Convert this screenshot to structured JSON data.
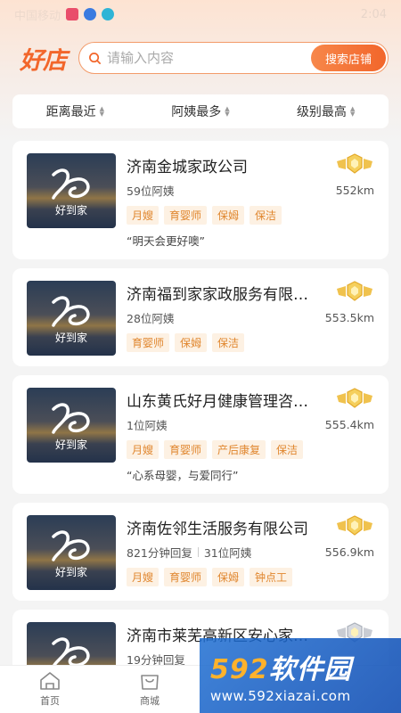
{
  "status_bar": {
    "left_text": "中国移动",
    "right_text": "2:04"
  },
  "header": {
    "logo": "好店"
  },
  "search": {
    "placeholder": "请输入内容",
    "button_label": "搜索店铺"
  },
  "filters": [
    {
      "label": "距离最近"
    },
    {
      "label": "阿姨最多"
    },
    {
      "label": "级别最高"
    }
  ],
  "thumb_caption": "好到家",
  "stores": [
    {
      "name": "济南金城家政公司",
      "reply": "",
      "count": "59位阿姨",
      "distance": "552km",
      "tags": [
        "月嫂",
        "育婴师",
        "保姆",
        "保洁"
      ],
      "slogan": "“明天会更好噢”",
      "badge": "gold"
    },
    {
      "name": "济南福到家家政服务有限…",
      "reply": "",
      "count": "28位阿姨",
      "distance": "553.5km",
      "tags": [
        "育婴师",
        "保姆",
        "保洁"
      ],
      "slogan": "",
      "badge": "gold"
    },
    {
      "name": "山东黄氏好月健康管理咨…",
      "reply": "",
      "count": "1位阿姨",
      "distance": "555.4km",
      "tags": [
        "月嫂",
        "育婴师",
        "产后康复",
        "保洁"
      ],
      "slogan": "“心系母婴，与爱同行”",
      "badge": "gold"
    },
    {
      "name": "济南佐邻生活服务有限公司",
      "reply": "821分钟回复",
      "count": "31位阿姨",
      "distance": "556.9km",
      "tags": [
        "月嫂",
        "育婴师",
        "保姆",
        "钟点工"
      ],
      "slogan": "",
      "badge": "gold"
    },
    {
      "name": "济南市莱芜高新区安心家…",
      "reply": "19分钟回复",
      "count": "",
      "distance": "",
      "tags": [],
      "slogan": "",
      "badge": "silver"
    }
  ],
  "tabbar": [
    {
      "label": "首页",
      "icon": "home-icon"
    },
    {
      "label": "商城",
      "icon": "shop-bag-icon"
    }
  ],
  "watermark": {
    "title_num": "592",
    "title_text": "软件园",
    "url": "www.592xiazai.com"
  },
  "colors": {
    "accent": "#f2662b",
    "tag_bg": "#fdf1e3",
    "tag_text": "#e0862e"
  }
}
